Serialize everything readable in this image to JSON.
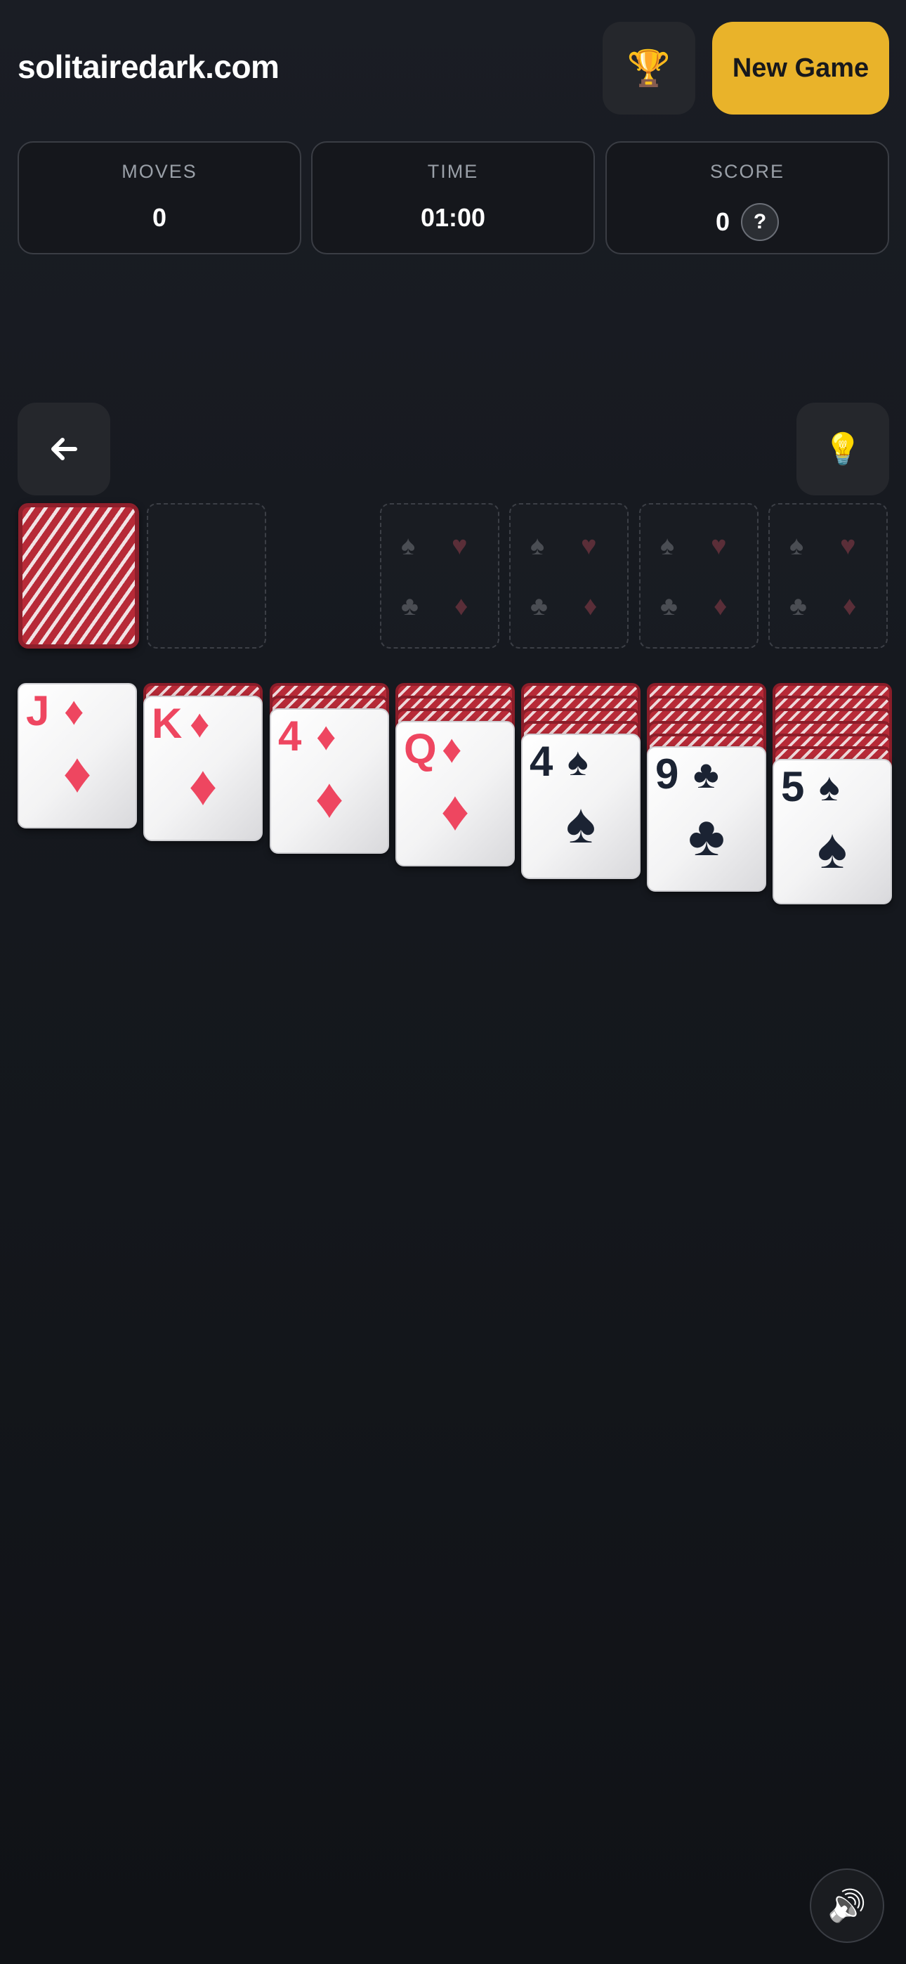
{
  "header": {
    "site_title": "solitairedark.com",
    "trophy_icon": "🏆",
    "new_game_label": "New Game"
  },
  "stats": {
    "moves_label": "MOVES",
    "moves_value": "0",
    "time_label": "TIME",
    "time_value": "01:00",
    "score_label": "SCORE",
    "score_value": "0",
    "score_help": "?"
  },
  "controls": {
    "undo_icon": "arrow-left-icon",
    "hint_icon": "💡"
  },
  "foundations": [
    {
      "suits": [
        "♠",
        "♥",
        "♣",
        "♦"
      ]
    },
    {
      "suits": [
        "♠",
        "♥",
        "♣",
        "♦"
      ]
    },
    {
      "suits": [
        "♠",
        "♥",
        "♣",
        "♦"
      ]
    },
    {
      "suits": [
        "♠",
        "♥",
        "♣",
        "♦"
      ]
    }
  ],
  "tableau": [
    {
      "face_down": 0,
      "rank": "J",
      "suit": "♦",
      "color": "red"
    },
    {
      "face_down": 1,
      "rank": "K",
      "suit": "♦",
      "color": "red"
    },
    {
      "face_down": 2,
      "rank": "4",
      "suit": "♦",
      "color": "red"
    },
    {
      "face_down": 3,
      "rank": "Q",
      "suit": "♦",
      "color": "red"
    },
    {
      "face_down": 4,
      "rank": "4",
      "suit": "♠",
      "color": "black"
    },
    {
      "face_down": 5,
      "rank": "9",
      "suit": "♣",
      "color": "black"
    },
    {
      "face_down": 6,
      "rank": "5",
      "suit": "♠",
      "color": "black"
    }
  ],
  "colors": {
    "accent": "#e9b32a",
    "card_red": "#ee4660",
    "card_black": "#1b2333",
    "card_back": "#b72a37"
  },
  "sound_icon": "🔊"
}
